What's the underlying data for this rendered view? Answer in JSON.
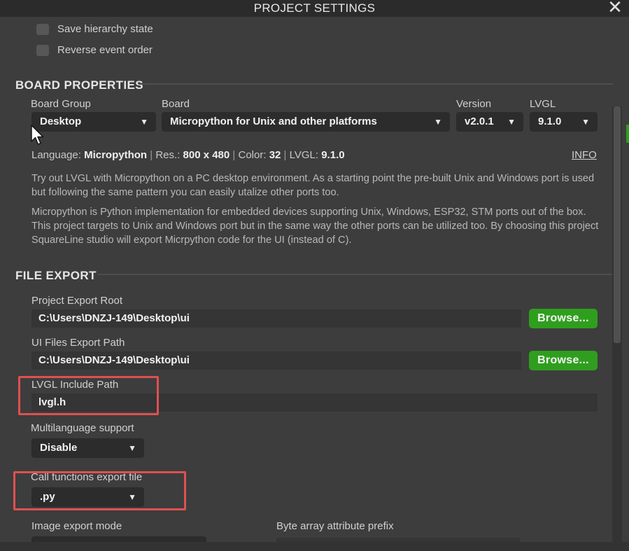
{
  "window": {
    "title": "PROJECT SETTINGS",
    "close_icon": "✕"
  },
  "top_options": [
    {
      "label": "Save hierarchy state",
      "checked": false
    },
    {
      "label": "Reverse event order",
      "checked": false
    }
  ],
  "board_properties": {
    "heading": "BOARD PROPERTIES",
    "board_group": {
      "label": "Board Group",
      "value": "Desktop"
    },
    "board": {
      "label": "Board",
      "value": "Micropython for Unix and other platforms"
    },
    "version": {
      "label": "Version",
      "value": "v2.0.1"
    },
    "lvgl": {
      "label": "LVGL",
      "value": "9.1.0"
    },
    "summary": {
      "language_label": "Language:",
      "language_value": "Micropython",
      "res_label": "Res.:",
      "res_value": "800 x 480",
      "color_label": "Color:",
      "color_value": "32",
      "lvgl_label": "LVGL:",
      "lvgl_value": "9.1.0",
      "separator": "|"
    },
    "info_link": "INFO",
    "description_1": "Try out LVGL with Micropython on a PC desktop environment. As a starting point the pre-built Unix and Windows port is used but following the same pattern you can easily utalize other ports too.",
    "description_2": "Micropython is Python implementation for embedded devices supporting Unix, Windows, ESP32, STM ports out of the box. This project targets to Unix and Windows port but in the same way the other ports can be utilized too. By choosing this project SquareLine studio will export Micrpython code for the UI (instead of C)."
  },
  "file_export": {
    "heading": "FILE EXPORT",
    "project_export_root": {
      "label": "Project Export Root",
      "value": "C:\\Users\\DNZJ-149\\Desktop\\ui",
      "button": "Browse..."
    },
    "ui_files_export_path": {
      "label": "UI Files Export Path",
      "value": "C:\\Users\\DNZJ-149\\Desktop\\ui",
      "button": "Browse..."
    },
    "lvgl_include_path": {
      "label": "LVGL Include Path",
      "value": "lvgl.h"
    },
    "multilanguage_support": {
      "label": "Multilanguage support",
      "value": "Disable"
    },
    "call_functions_export_file": {
      "label": "Call functions export file",
      "value": ".py"
    },
    "image_export_mode": {
      "label": "Image export mode"
    },
    "byte_array_attribute_prefix": {
      "label": "Byte array attribute prefix"
    }
  },
  "colors": {
    "accent_green": "#2f9e1e",
    "highlight_red": "#e05050",
    "background": "#3d3d3d"
  },
  "icons": {
    "caret": "▼",
    "cursor": "mouse-pointer-icon"
  }
}
